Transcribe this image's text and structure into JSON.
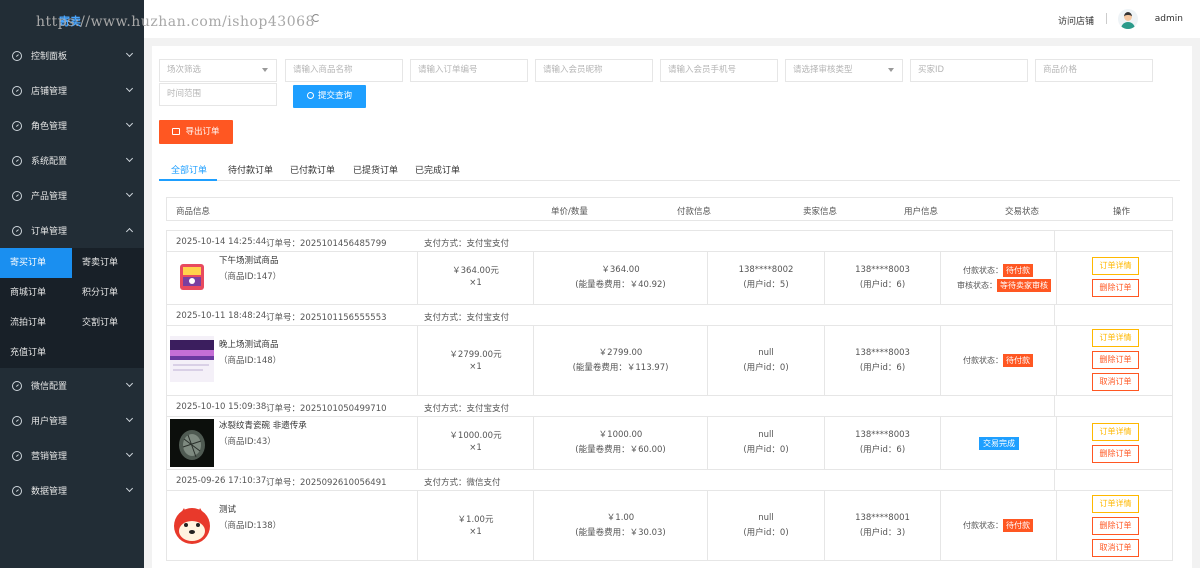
{
  "watermark": "https://www.huzhan.com/ishop43068",
  "logo": "寄卖",
  "header": {
    "visit_shop": "访问店铺",
    "user": "admin"
  },
  "sidebar": {
    "items_top": [
      {
        "label": "控制面板"
      },
      {
        "label": "店铺管理"
      },
      {
        "label": "角色管理"
      },
      {
        "label": "系统配置"
      },
      {
        "label": "产品管理"
      },
      {
        "label": "订单管理"
      }
    ],
    "sub_items": [
      {
        "label": "寄买订单"
      },
      {
        "label": "寄卖订单"
      },
      {
        "label": "商城订单"
      },
      {
        "label": "积分订单"
      },
      {
        "label": "流拍订单"
      },
      {
        "label": "交割订单"
      },
      {
        "label": "充值订单"
      }
    ],
    "items_bottom": [
      {
        "label": "微信配置"
      },
      {
        "label": "用户管理"
      },
      {
        "label": "营销管理"
      },
      {
        "label": "数据管理"
      }
    ]
  },
  "filters": {
    "session": "场次筛选",
    "product_name": "请输入商品名称",
    "order_no": "请输入订单编号",
    "member_nick": "请输入会员昵称",
    "member_phone": "请输入会员手机号",
    "audit_type": "请选择审核类型",
    "buyer_id": "买家ID",
    "price": "商品价格",
    "time_range": "时间范围",
    "submit": "提交查询",
    "export": "导出订单"
  },
  "tabs": [
    "全部订单",
    "待付款订单",
    "已付款订单",
    "已提货订单",
    "已完成订单"
  ],
  "columns": [
    "商品信息",
    "单价/数量",
    "付款信息",
    "卖家信息",
    "用户信息",
    "交易状态",
    "操作"
  ],
  "orders": [
    {
      "time": "2025-10-14 14:25:44",
      "order_no": "订单号：2025101456485799",
      "pay_method": "支付方式：支付宝支付",
      "name": "下午场测试商品",
      "pid": "（商品ID:147）",
      "unit_price": "￥364.00元",
      "qty": "×1",
      "pay": "￥364.00",
      "fee": "(能量卷费用：￥40.92)",
      "seller": "138****8002",
      "seller_id": "(用户id：5)",
      "user": "138****8003",
      "user_id": "(用户id：6)",
      "status_label": "付款状态：",
      "status_tag": "待付款",
      "audit_label": "审核状态：",
      "audit_tag": "等待卖家审核",
      "btn_detail": "订单详情",
      "btn_delete": "删除订单"
    },
    {
      "time": "2025-10-11 18:48:24",
      "order_no": "订单号：2025101156555553",
      "pay_method": "支付方式：支付宝支付",
      "name": "晚上场测试商品",
      "pid": "（商品ID:148）",
      "unit_price": "￥2799.00元",
      "qty": "×1",
      "pay": "￥2799.00",
      "fee": "(能量卷费用：￥113.97)",
      "seller": "null",
      "seller_id": "(用户id：0)",
      "user": "138****8003",
      "user_id": "(用户id：6)",
      "status_label": "付款状态：",
      "status_tag": "待付款",
      "btn_detail": "订单详情",
      "btn_delete": "删除订单",
      "btn_cancel": "取消订单"
    },
    {
      "time": "2025-10-10 15:09:38",
      "order_no": "订单号：2025101050499710",
      "pay_method": "支付方式：支付宝支付",
      "name": "冰裂纹青瓷碗 非遗传承",
      "pid": "（商品ID:43）",
      "unit_price": "￥1000.00元",
      "qty": "×1",
      "pay": "￥1000.00",
      "fee": "(能量卷费用：￥60.00)",
      "seller": "null",
      "seller_id": "(用户id：0)",
      "user": "138****8003",
      "user_id": "(用户id：6)",
      "status_tag": "交易完成",
      "btn_detail": "订单详情",
      "btn_delete": "删除订单"
    },
    {
      "time": "2025-09-26 17:10:37",
      "order_no": "订单号：2025092610056491",
      "pay_method": "支付方式：微信支付",
      "name": "测试",
      "pid": "（商品ID:138）",
      "unit_price": "￥1.00元",
      "qty": "×1",
      "pay": "￥1.00",
      "fee": "(能量卷费用：￥30.03)",
      "seller": "null",
      "seller_id": "(用户id：0)",
      "user": "138****8001",
      "user_id": "(用户id：3)",
      "status_label": "付款状态：",
      "status_tag": "待付款",
      "btn_detail": "订单详情",
      "btn_delete": "删除订单",
      "btn_cancel": "取消订单"
    }
  ]
}
